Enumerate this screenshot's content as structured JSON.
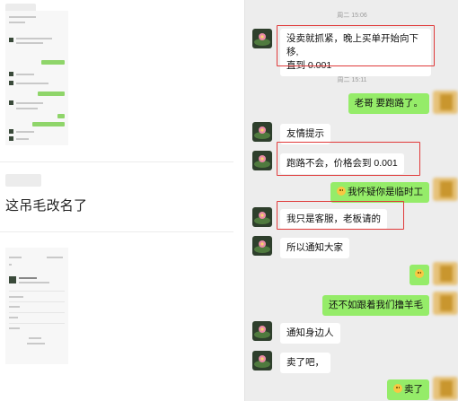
{
  "left": {
    "post_text": "这吊毛改名了"
  },
  "chat": {
    "messages": [
      {
        "id": "ts1",
        "type": "timestamp",
        "text": "周二 15:06"
      },
      {
        "id": "m1",
        "side": "left",
        "line1": "没卖就抓紧，晚上买单开始向下移,",
        "line2": "直到 0.001",
        "highlighted": true
      },
      {
        "id": "ts2",
        "type": "timestamp",
        "text": "周二 15:11"
      },
      {
        "id": "m2",
        "side": "right",
        "text": "老哥 要跑路了。"
      },
      {
        "id": "m3",
        "side": "left",
        "text": "友情提示"
      },
      {
        "id": "m4",
        "side": "left",
        "text": "跑路不会，价格会到 0.001",
        "highlighted": true
      },
      {
        "id": "m5",
        "side": "right",
        "text": "我怀疑你是临时工",
        "emoji": "smile-emoji-icon"
      },
      {
        "id": "m6",
        "side": "left",
        "text": "我只是客服，老板请的",
        "highlighted": true
      },
      {
        "id": "m7",
        "side": "left",
        "text": "所以通知大家"
      },
      {
        "id": "m8",
        "side": "right",
        "emoji": "smile-emoji-icon"
      },
      {
        "id": "m9",
        "side": "right",
        "text": "还不如跟着我们撸羊毛"
      },
      {
        "id": "m10",
        "side": "left",
        "text": "通知身边人"
      },
      {
        "id": "m11",
        "side": "left",
        "text": "卖了吧，"
      },
      {
        "id": "m12",
        "side": "right",
        "text": "卖了",
        "emoji": "smile-emoji-icon"
      }
    ]
  },
  "colors": {
    "chat_bg": "#ededed",
    "bubble_green": "#95ec69",
    "bubble_white": "#ffffff",
    "highlight_border": "#e03a3a"
  }
}
